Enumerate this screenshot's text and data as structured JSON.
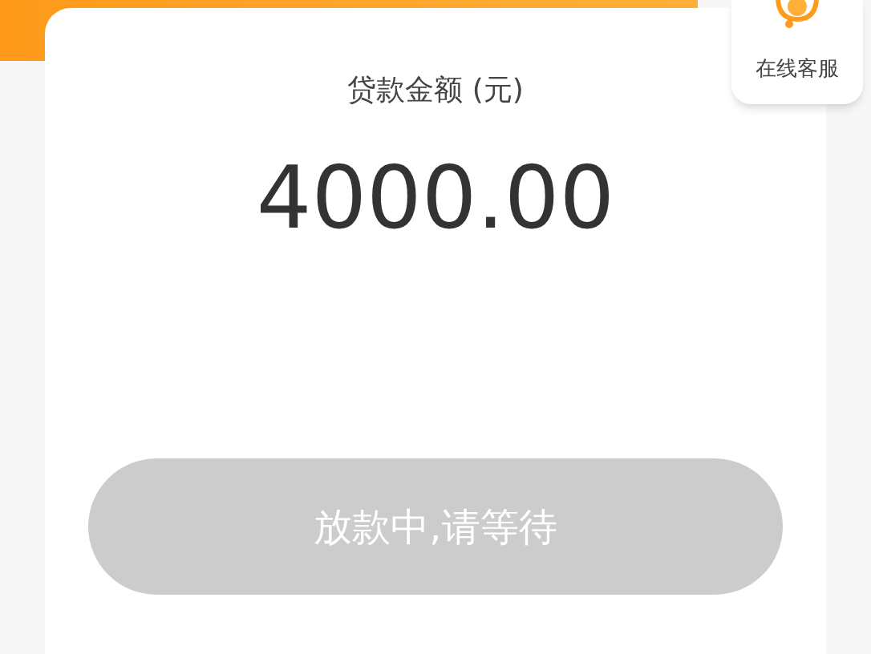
{
  "loan": {
    "label": "贷款金额 (元)",
    "amount": "4000.00"
  },
  "action_button": {
    "label": "放款中,请等待",
    "disabled": true
  },
  "support": {
    "label": "在线客服"
  }
}
